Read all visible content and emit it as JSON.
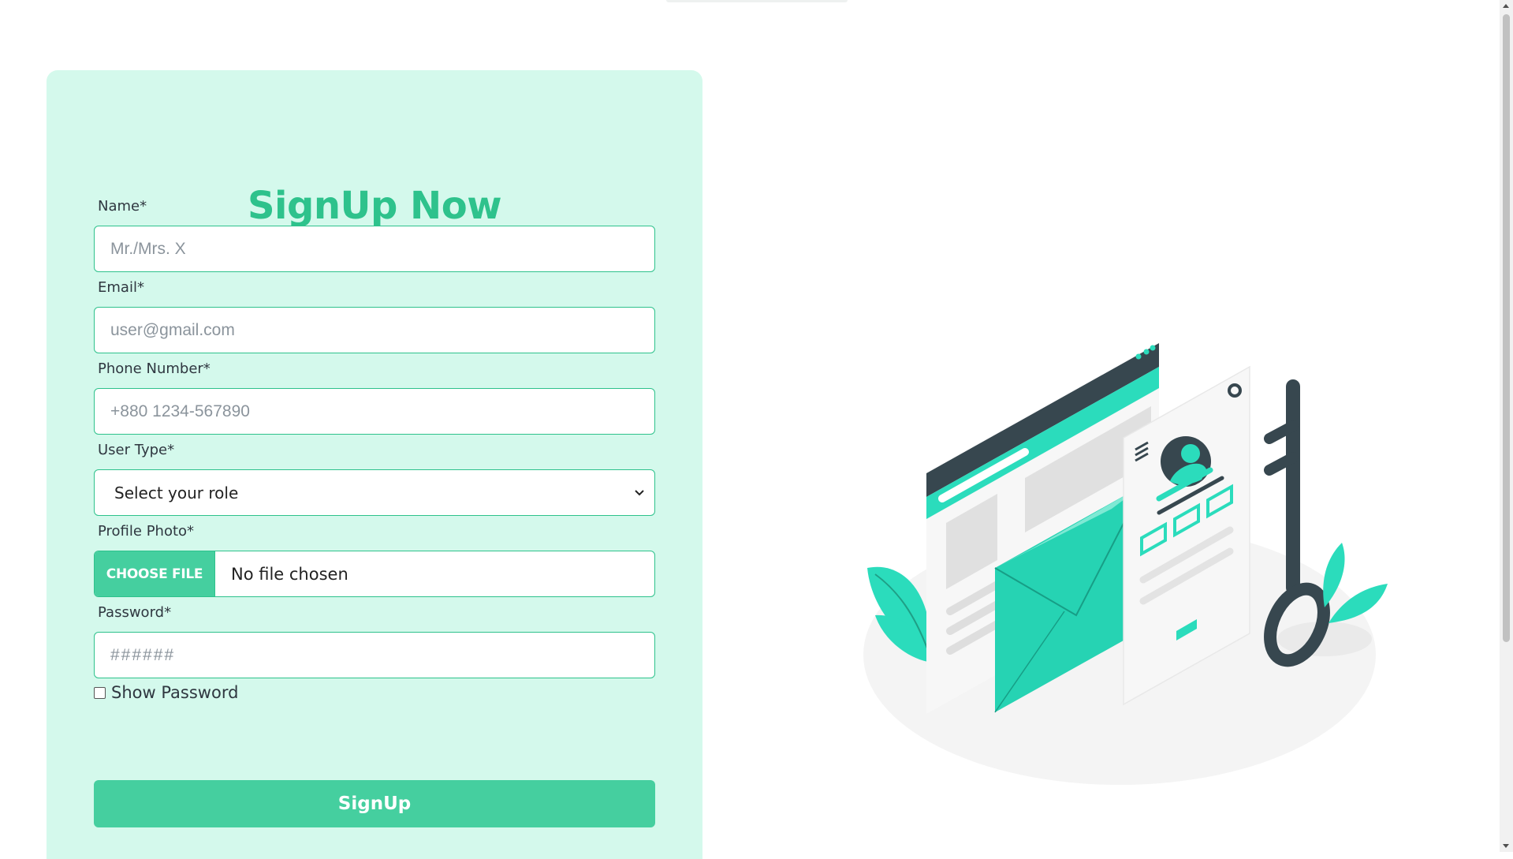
{
  "form": {
    "title": "SignUp Now",
    "fields": {
      "name": {
        "label": "Name*",
        "placeholder": "Mr./Mrs. X"
      },
      "email": {
        "label": "Email*",
        "placeholder": "user@gmail.com"
      },
      "phone": {
        "label": "Phone Number*",
        "placeholder": "+880 1234-567890"
      },
      "user_type": {
        "label": "User Type*",
        "selected": "Select your role"
      },
      "profile_photo": {
        "label": "Profile Photo*",
        "button": "CHOOSE FILE",
        "status": "No file chosen"
      },
      "password": {
        "label": "Password*",
        "placeholder": "######"
      }
    },
    "show_password_label": "Show Password",
    "submit_label": "SignUp"
  },
  "illustration": {
    "icon": "signup-email-key-illustration"
  },
  "colors": {
    "accent": "#2ec28c",
    "button": "#45cf9f",
    "card_background": "#d4f9ec",
    "illustration_teal": "#2bdcbc",
    "illustration_dark": "#37474f"
  }
}
